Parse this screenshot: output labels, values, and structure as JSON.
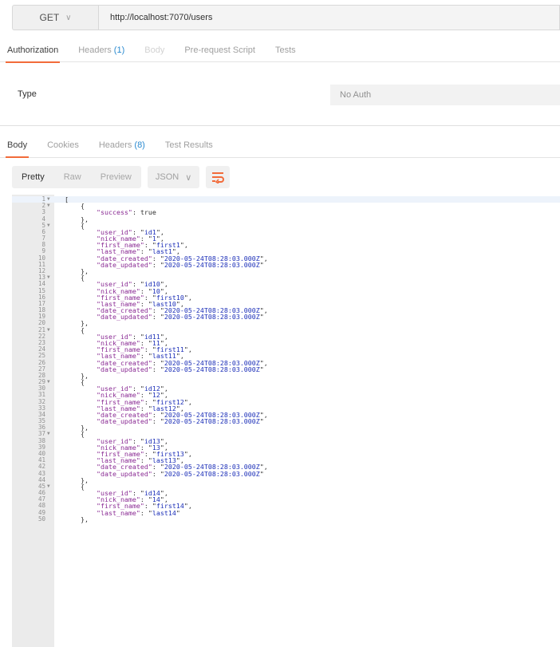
{
  "request": {
    "method": "GET",
    "url": "http://localhost:7070/users"
  },
  "request_tabs": [
    {
      "label": "Authorization",
      "count": "",
      "state": "active"
    },
    {
      "label": "Headers",
      "count": "(1)",
      "state": "normal"
    },
    {
      "label": "Body",
      "count": "",
      "state": "disabled"
    },
    {
      "label": "Pre-request Script",
      "count": "",
      "state": "normal"
    },
    {
      "label": "Tests",
      "count": "",
      "state": "normal"
    }
  ],
  "auth": {
    "type_label": "Type",
    "type_value": "No Auth"
  },
  "response_tabs": [
    {
      "label": "Body",
      "count": "",
      "state": "active"
    },
    {
      "label": "Cookies",
      "count": "",
      "state": "normal"
    },
    {
      "label": "Headers",
      "count": "(8)",
      "state": "normal"
    },
    {
      "label": "Test Results",
      "count": "",
      "state": "normal"
    }
  ],
  "view_buttons": [
    {
      "label": "Pretty",
      "active": true
    },
    {
      "label": "Raw",
      "active": false
    },
    {
      "label": "Preview",
      "active": false
    }
  ],
  "format": "JSON",
  "colors": {
    "accent": "#f26b3a",
    "count": "#2a8ad0",
    "json_key": "#8a2b94",
    "json_string": "#1c2fb8"
  },
  "icons": {
    "method_dropdown": "chevron-down-icon",
    "format_dropdown": "chevron-down-icon",
    "wrap": "wrap-lines-icon",
    "fold": "fold-arrow-icon"
  },
  "response_body": {
    "header": {
      "success": "true"
    },
    "users": [
      {
        "user_id": "id1",
        "nick_name": "1",
        "first_name": "first1",
        "last_name": "last1",
        "date_created": "2020-05-24T08:28:03.000Z",
        "date_updated": "2020-05-24T08:28:03.000Z"
      },
      {
        "user_id": "id10",
        "nick_name": "10",
        "first_name": "first10",
        "last_name": "last10",
        "date_created": "2020-05-24T08:28:03.000Z",
        "date_updated": "2020-05-24T08:28:03.000Z"
      },
      {
        "user_id": "id11",
        "nick_name": "11",
        "first_name": "first11",
        "last_name": "last11",
        "date_created": "2020-05-24T08:28:03.000Z",
        "date_updated": "2020-05-24T08:28:03.000Z"
      },
      {
        "user_id": "id12",
        "nick_name": "12",
        "first_name": "first12",
        "last_name": "last12",
        "date_created": "2020-05-24T08:28:03.000Z",
        "date_updated": "2020-05-24T08:28:03.000Z"
      },
      {
        "user_id": "id13",
        "nick_name": "13",
        "first_name": "first13",
        "last_name": "last13",
        "date_created": "2020-05-24T08:28:03.000Z",
        "date_updated": "2020-05-24T08:28:03.000Z"
      },
      {
        "user_id": "id14",
        "nick_name": "14",
        "first_name": "first14",
        "last_name": "last14"
      }
    ]
  }
}
